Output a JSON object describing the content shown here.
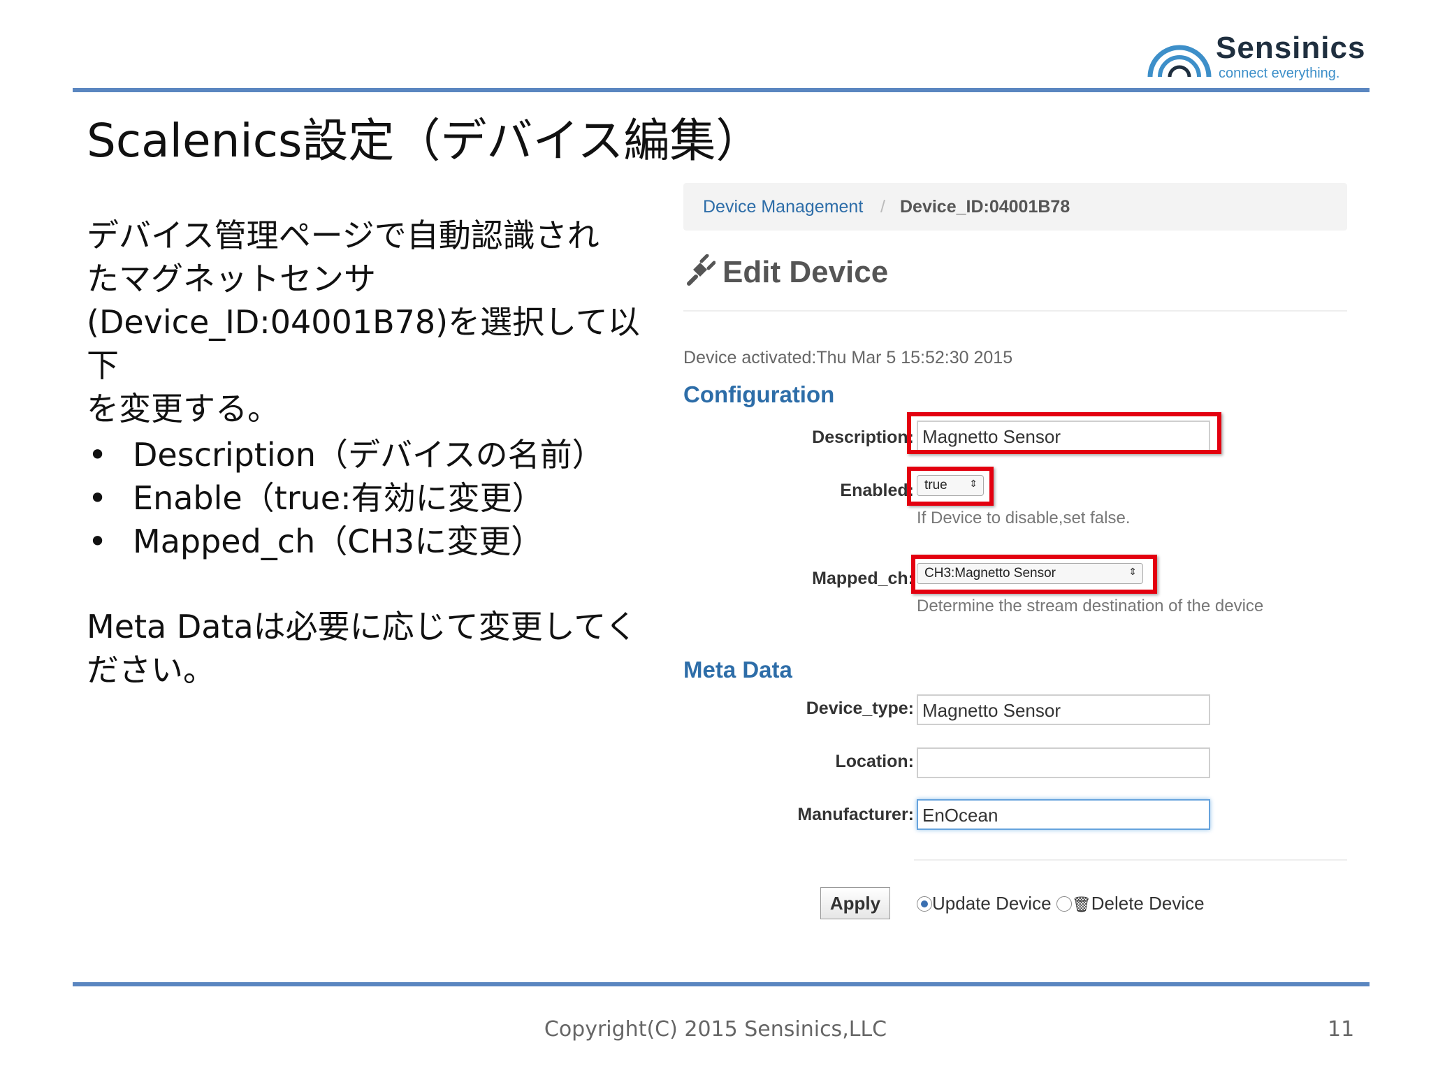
{
  "logo": {
    "name": "Sensinics",
    "tagline": "connect everything."
  },
  "title": "Scalenics設定（デバイス編集）",
  "intro": {
    "line1": "デバイス管理ページで自動認識され",
    "line2": "たマグネットセンサ",
    "line3": "(Device_ID:04001B78)を選択して以下",
    "line4": "を変更する。"
  },
  "bullets": [
    "Description（デバイスの名前）",
    "Enable（true:有効に変更）",
    "Mapped_ch（CH3に変更）"
  ],
  "note": {
    "line1": "Meta Dataは必要に応じて変更してく",
    "line2": "ださい。"
  },
  "screenshot": {
    "breadcrumb": {
      "link": "Device Management",
      "separator": "/",
      "current": "Device_ID:04001B78"
    },
    "heading": "Edit Device",
    "activated": "Device activated:Thu Mar 5 15:52:30 2015",
    "configuration": {
      "title": "Configuration",
      "description_label": "Description:",
      "description_value": "Magnetto Sensor",
      "enabled_label": "Enabled:",
      "enabled_value": "true",
      "enabled_help": "If Device to disable,set false.",
      "mapped_label": "Mapped_ch:",
      "mapped_value": "CH3:Magnetto Sensor",
      "mapped_help": "Determine the stream destination of the device"
    },
    "meta": {
      "title": "Meta Data",
      "device_type_label": "Device_type:",
      "device_type_value": "Magnetto Sensor",
      "location_label": "Location:",
      "location_value": "",
      "manufacturer_label": "Manufacturer:",
      "manufacturer_value": "EnOcean"
    },
    "apply_label": "Apply",
    "update_label": "Update Device",
    "delete_label": "Delete Device"
  },
  "footer": {
    "copyright": "Copyright(C) 2015 Sensinics,LLC",
    "page": "11"
  },
  "colors": {
    "rule": "#5a86c0",
    "highlight": "#e3000f",
    "link": "#2d6da8"
  }
}
